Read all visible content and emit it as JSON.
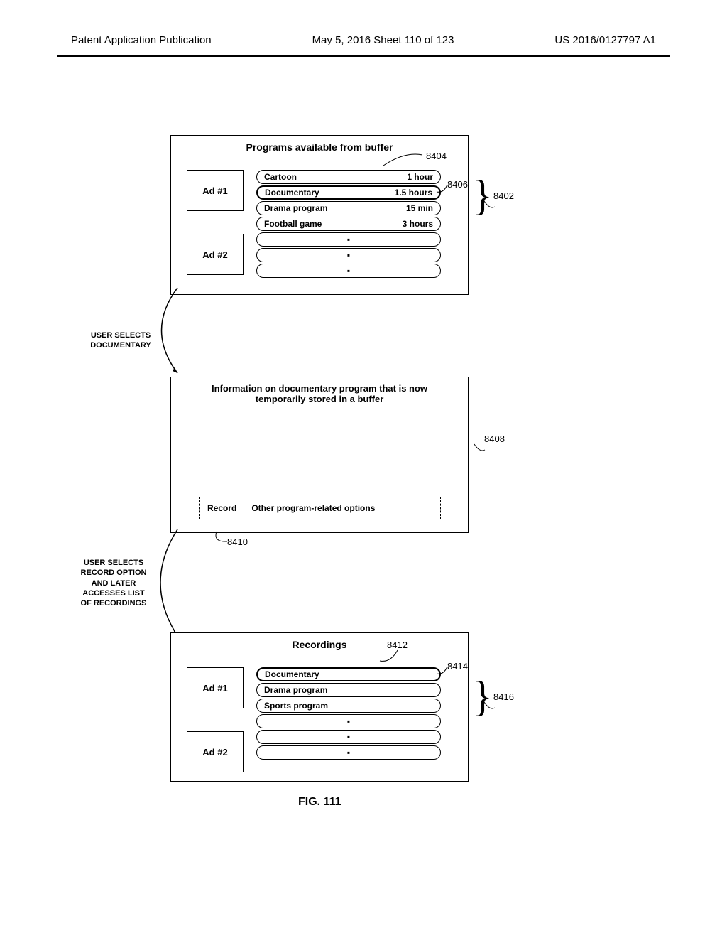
{
  "header": {
    "left": "Patent Application Publication",
    "center": "May 5, 2016  Sheet 110 of 123",
    "right": "US 2016/0127797 A1"
  },
  "panel1": {
    "title": "Programs available from buffer",
    "ad1": "Ad #1",
    "ad2": "Ad #2",
    "items": [
      {
        "name": "Cartoon",
        "dur": "1 hour"
      },
      {
        "name": "Documentary",
        "dur": "1.5 hours"
      },
      {
        "name": "Drama program",
        "dur": "15 min"
      },
      {
        "name": "Football game",
        "dur": "3 hours"
      }
    ],
    "ref_top": "8404",
    "ref_item": "8406",
    "ref_panel": "8402"
  },
  "arrow1_caption": "USER SELECTS\nDOCUMENTARY",
  "panel2": {
    "title": "Information on documentary program that is now temporarily stored in a buffer",
    "record": "Record",
    "other": "Other program-related options",
    "ref_panel": "8408",
    "ref_record": "8410"
  },
  "arrow2_caption": "USER SELECTS\nRECORD OPTION\nAND LATER\nACCESSES LIST\nOF RECORDINGS",
  "panel3": {
    "title": "Recordings",
    "ad1": "Ad #1",
    "ad2": "Ad #2",
    "items": [
      {
        "name": "Documentary"
      },
      {
        "name": "Drama program"
      },
      {
        "name": "Sports program"
      }
    ],
    "ref_top": "8412",
    "ref_item": "8414",
    "ref_panel": "8416"
  },
  "figure_caption": "FIG. 111"
}
